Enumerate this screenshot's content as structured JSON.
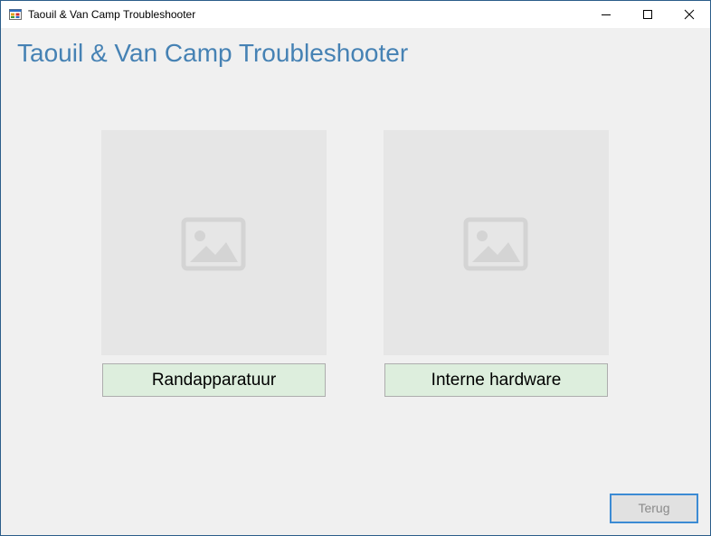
{
  "window": {
    "title": "Taouil & Van Camp Troubleshooter",
    "icon": "app-window-icon",
    "controls": [
      "minimize-icon",
      "maximize-icon",
      "close-icon"
    ]
  },
  "main": {
    "heading": "Taouil & Van Camp Troubleshooter",
    "heading_color": "#4682b4",
    "categories": [
      {
        "image_icon": "image-placeholder-icon",
        "label": "Randapparatuur"
      },
      {
        "image_icon": "image-placeholder-icon",
        "label": "Interne hardware"
      }
    ],
    "button_color": "#ddeedd",
    "back_label": "Terug"
  }
}
